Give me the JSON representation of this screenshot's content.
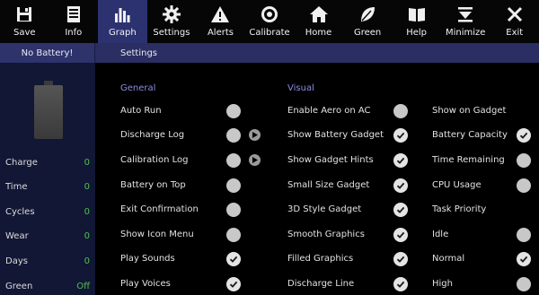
{
  "toolbar": [
    {
      "label": "Save",
      "icon": "save-icon"
    },
    {
      "label": "Info",
      "icon": "info-icon"
    },
    {
      "label": "Graph",
      "icon": "graph-icon",
      "active": true
    },
    {
      "label": "Settings",
      "icon": "gear-icon"
    },
    {
      "label": "Alerts",
      "icon": "warning-icon"
    },
    {
      "label": "Calibrate",
      "icon": "target-icon"
    },
    {
      "label": "Home",
      "icon": "home-icon"
    },
    {
      "label": "Green",
      "icon": "leaf-icon"
    },
    {
      "label": "Help",
      "icon": "book-icon"
    },
    {
      "label": "Minimize",
      "icon": "minimize-icon"
    },
    {
      "label": "Exit",
      "icon": "close-icon"
    }
  ],
  "header": {
    "status": "No Battery!",
    "section": "Settings"
  },
  "side": {
    "stats": [
      {
        "label": "Charge",
        "value": "0"
      },
      {
        "label": "Time",
        "value": "0"
      },
      {
        "label": "Cycles",
        "value": "0"
      },
      {
        "label": "Wear",
        "value": "0"
      },
      {
        "label": "Days",
        "value": "0"
      },
      {
        "label": "Green",
        "value": "Off"
      }
    ]
  },
  "general": {
    "title": "General",
    "items": [
      {
        "label": "Auto Run",
        "checked": false
      },
      {
        "label": "Discharge Log",
        "checked": false,
        "play": true
      },
      {
        "label": "Calibration Log",
        "checked": false,
        "play": true
      },
      {
        "label": "Battery on Top",
        "checked": false
      },
      {
        "label": "Exit Confirmation",
        "checked": false
      },
      {
        "label": "Show Icon Menu",
        "checked": false
      },
      {
        "label": "Play Sounds",
        "checked": true
      },
      {
        "label": "Play Voices",
        "checked": true
      }
    ]
  },
  "visual": {
    "title": "Visual",
    "items": [
      {
        "label": "Enable Aero on AC",
        "checked": false
      },
      {
        "label": "Show Battery Gadget",
        "checked": true
      },
      {
        "label": "Show Gadget Hints",
        "checked": true
      },
      {
        "label": "Small Size Gadget",
        "checked": true
      },
      {
        "label": "3D Style Gadget",
        "checked": true
      },
      {
        "label": "Smooth Graphics",
        "checked": true
      },
      {
        "label": "Filled Graphics",
        "checked": true
      },
      {
        "label": "Discharge Line",
        "checked": true
      }
    ]
  },
  "gadget": {
    "items": [
      {
        "label": "Show on Gadget",
        "toggle": false
      },
      {
        "label": "Battery Capacity",
        "toggle": true,
        "checked": true
      },
      {
        "label": "Time Remaining",
        "toggle": true,
        "checked": false
      },
      {
        "label": "CPU Usage",
        "toggle": true,
        "checked": false
      },
      {
        "label": "Task Priority",
        "toggle": false
      },
      {
        "label": "Idle",
        "toggle": true,
        "checked": false
      },
      {
        "label": "Normal",
        "toggle": true,
        "checked": true
      },
      {
        "label": "High",
        "toggle": true,
        "checked": false
      }
    ]
  },
  "colors": {
    "toolbar_active": "#2c3270",
    "header": "#2a2e62",
    "side_panel": "#121735",
    "section_title": "#8b8fe0",
    "stat_value": "#4ec04e"
  }
}
